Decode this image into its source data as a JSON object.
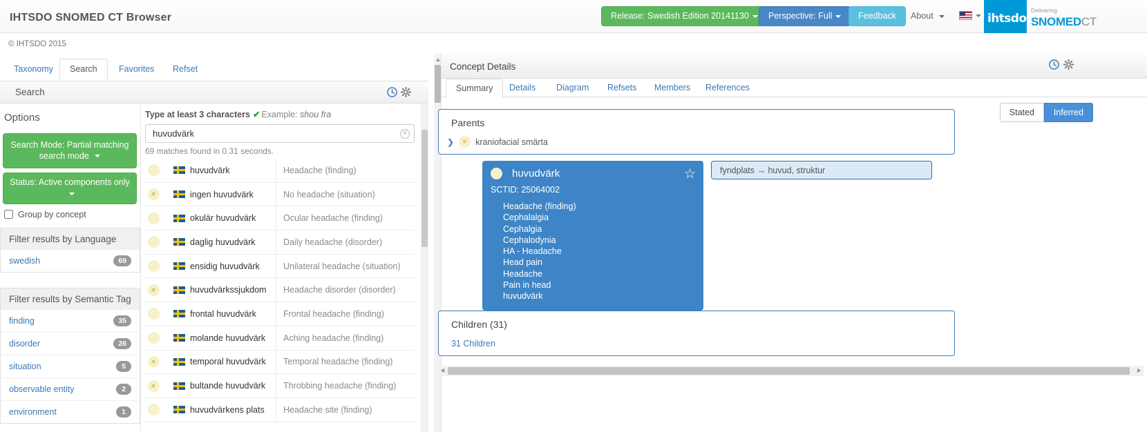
{
  "header": {
    "app_title": "IHTSDO SNOMED CT Browser",
    "release_button": "Release: Swedish Edition 20141130",
    "perspective_button": "Perspective: Full",
    "feedback_button": "Feedback",
    "about_menu": "About",
    "language_flag": "us-flag-icon",
    "logo_ihtsdo": "ihtsdo",
    "logo_delivering": "Delivering",
    "logo_snomed": "SNOMED",
    "logo_ct": "CT",
    "copyright": "© IHTSDO 2015"
  },
  "main_tabs": [
    {
      "label": "Taxonomy",
      "active": false
    },
    {
      "label": "Search",
      "active": true
    },
    {
      "label": "Favorites",
      "active": false
    },
    {
      "label": "Refset",
      "active": false
    }
  ],
  "search_panel": {
    "title": "Search",
    "history_icon": "clock-icon",
    "settings_icon": "gear-icon",
    "type_hint": "Type at least 3 characters",
    "check_mark": "✔",
    "example_label": "Example:",
    "example_value": "shou fra",
    "query_value": "huvudvärk",
    "query_placeholder": "",
    "clear_icon": "clear-icon",
    "match_info": "69 matches found in 0.31 seconds."
  },
  "options": {
    "title": "Options",
    "search_mode_button": "Search Mode: Partial matching search mode",
    "status_button": "Status: Active components only",
    "group_by_concept": "Group by concept",
    "group_by_checked": false,
    "language_filter_title": "Filter results by Language",
    "language_filters": [
      {
        "label": "swedish",
        "count": "69"
      }
    ],
    "semantic_filter_title": "Filter results by Semantic Tag",
    "semantic_filters": [
      {
        "label": "finding",
        "count": "35"
      },
      {
        "label": "disorder",
        "count": "26"
      },
      {
        "label": "situation",
        "count": "5"
      },
      {
        "label": "observable entity",
        "count": "2"
      },
      {
        "label": "environment",
        "count": "1"
      }
    ]
  },
  "results": [
    {
      "icon": "concept-dot",
      "has_lines": false,
      "flag": "swedish-flag",
      "term": "huvudvärk",
      "english": "Headache (finding)"
    },
    {
      "icon": "concept-dot",
      "has_lines": true,
      "flag": "swedish-flag",
      "term": "ingen huvudvärk",
      "english": "No headache (situation)"
    },
    {
      "icon": "concept-dot",
      "has_lines": false,
      "flag": "swedish-flag",
      "term": "okulär huvudvärk",
      "english": "Ocular headache (finding)"
    },
    {
      "icon": "concept-dot",
      "has_lines": false,
      "flag": "swedish-flag",
      "term": "daglig huvudvärk",
      "english": "Daily headache (disorder)"
    },
    {
      "icon": "concept-dot",
      "has_lines": false,
      "flag": "swedish-flag",
      "term": "ensidig huvudvärk",
      "english": "Unilateral headache (situation)"
    },
    {
      "icon": "concept-dot",
      "has_lines": true,
      "flag": "swedish-flag",
      "term": "huvudvärkssjukdom",
      "english": "Headache disorder (disorder)"
    },
    {
      "icon": "concept-dot",
      "has_lines": false,
      "flag": "swedish-flag",
      "term": "frontal huvudvärk",
      "english": "Frontal headache (finding)"
    },
    {
      "icon": "concept-dot",
      "has_lines": false,
      "flag": "swedish-flag",
      "term": "molande huvudvärk",
      "english": "Aching headache (finding)"
    },
    {
      "icon": "concept-dot",
      "has_lines": true,
      "flag": "swedish-flag",
      "term": "temporal huvudvärk",
      "english": "Temporal headache (finding)"
    },
    {
      "icon": "concept-dot",
      "has_lines": true,
      "flag": "swedish-flag",
      "term": "bultande huvudvärk",
      "english": "Throbbing headache (finding)"
    },
    {
      "icon": "concept-dot",
      "has_lines": false,
      "flag": "swedish-flag",
      "term": "huvudvärkens plats",
      "english": "Headache site (finding)"
    }
  ],
  "concept_details": {
    "title": "Concept Details",
    "history_icon": "clock-icon",
    "settings_icon": "gear-icon",
    "tabs": [
      {
        "label": "Summary",
        "active": true
      },
      {
        "label": "Details",
        "active": false
      },
      {
        "label": "Diagram",
        "active": false
      },
      {
        "label": "Refsets",
        "active": false
      },
      {
        "label": "Members",
        "active": false
      },
      {
        "label": "References",
        "active": false
      }
    ],
    "view_toggle": [
      {
        "label": "Stated",
        "active": false
      },
      {
        "label": "Inferred",
        "active": true
      }
    ],
    "parents_label": "Parents",
    "parents": [
      {
        "expand_icon": "chevron-right-icon",
        "icon": "concept-dot",
        "label": "kraniofacial smärta"
      }
    ],
    "concept": {
      "term": "huvudvärk",
      "sctid_label": "SCTID: 25064002",
      "star_icon": "star-icon",
      "synonyms": [
        "Headache (finding)",
        "Cephalalgia",
        "Cephalgia",
        "Cephalodynia",
        "HA - Headache",
        "Head pain",
        "Headache",
        "Pain in head",
        "huvudvärk"
      ]
    },
    "attributes": [
      {
        "text": "fyndplats →  huvud, struktur"
      }
    ],
    "children_label": "Children (31)",
    "children_link": "31 Children"
  },
  "colors": {
    "green": "#5cb85c",
    "blue": "#4a87c7",
    "light_blue": "#5bc0de",
    "card_blue": "#3d85c6",
    "link": "#3c78b4",
    "snomed_blue": "#0099d8"
  }
}
